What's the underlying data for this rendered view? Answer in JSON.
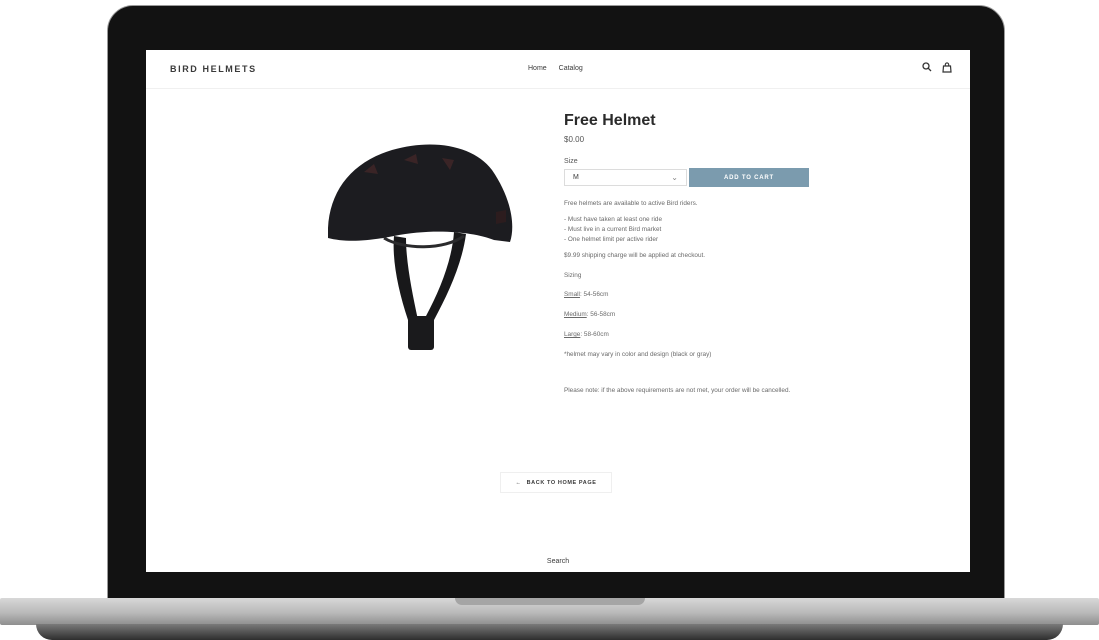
{
  "store": {
    "name": "BIRD HELMETS",
    "nav": [
      "Home",
      "Catalog"
    ]
  },
  "product": {
    "title": "Free Helmet",
    "price": "$0.00",
    "size_label": "Size",
    "size_value": "M",
    "add_to_cart": "ADD TO CART",
    "intro": "Free helmets are available to active Bird riders.",
    "requirements": [
      "- Must have taken at least one ride",
      "- Must live in a current Bird market",
      "- One helmet limit per active rider"
    ],
    "shipping": "$9.99 shipping charge will be applied at checkout.",
    "sizing_heading": "Sizing",
    "sizes": [
      {
        "name": "Small",
        "range": ": 54-56cm"
      },
      {
        "name": "Medium",
        "range": ": 56-58cm"
      },
      {
        "name": "Large",
        "range": ": 58-60cm"
      }
    ],
    "variation_note": "*helmet may vary in color and design (black or gray)",
    "note": "Please note: if the above requirements are not met, your order will be cancelled."
  },
  "back_label": "BACK TO HOME PAGE",
  "footer_link": "Search",
  "colors": {
    "button": "#7b9bae",
    "frame": "#121212"
  },
  "icons": [
    "search-icon",
    "cart-icon",
    "chevron-down-icon",
    "arrow-left-icon",
    "helmet-image"
  ]
}
